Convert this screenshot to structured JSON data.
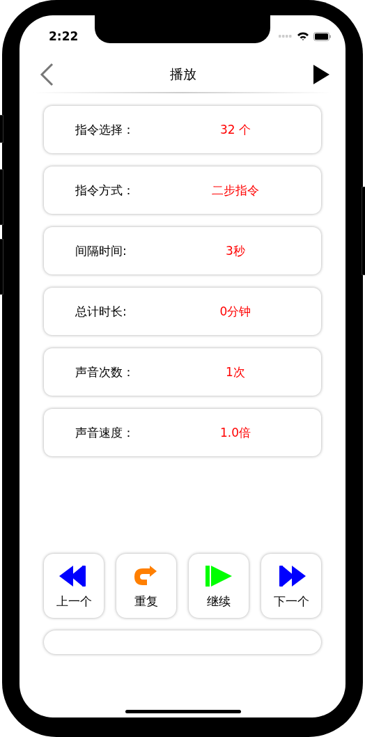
{
  "status_bar": {
    "time": "2:22"
  },
  "nav": {
    "title": "播放"
  },
  "settings": [
    {
      "label": "指令选择：",
      "value": "32 个"
    },
    {
      "label": "指令方式：",
      "value": "二步指令"
    },
    {
      "label": "间隔时间:",
      "value": "3秒"
    },
    {
      "label": "总计时长:",
      "value": "0分钟"
    },
    {
      "label": "声音次数：",
      "value": "1次"
    },
    {
      "label": "声音速度：",
      "value": "1.0倍"
    }
  ],
  "controls": [
    {
      "kind": "previous",
      "label": "上一个"
    },
    {
      "kind": "repeat",
      "label": "重复"
    },
    {
      "kind": "resume",
      "label": "继续"
    },
    {
      "kind": "next",
      "label": "下一个"
    }
  ]
}
